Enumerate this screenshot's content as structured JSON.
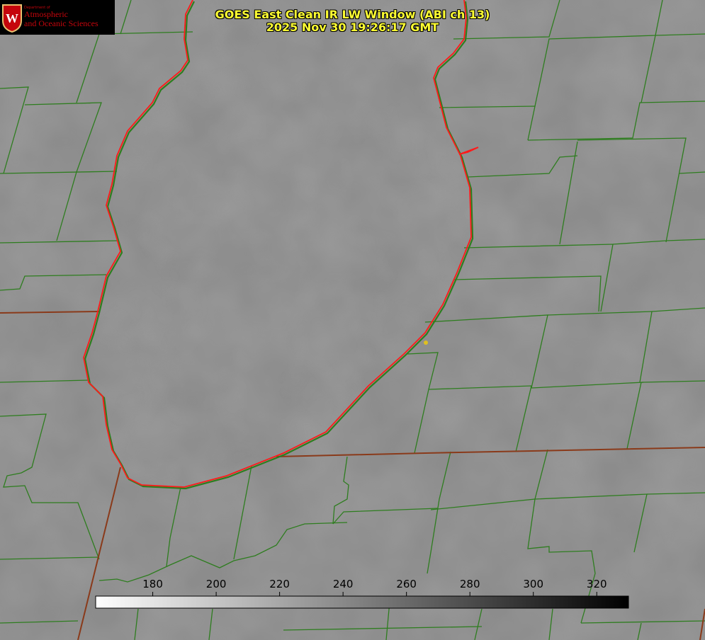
{
  "title": {
    "line1": "GOES East Clean IR LW Window (ABI ch 13)",
    "line2": "2025 Nov 30 19:26:17 GMT"
  },
  "logo": {
    "dept": "Department of",
    "line1": "Atmospheric",
    "line2": "and Oceanic Sciences",
    "seal_letter": "W"
  },
  "colorbar": {
    "ticks": [
      "180",
      "200",
      "220",
      "240",
      "260",
      "280",
      "300",
      "320"
    ],
    "tick_values": [
      180,
      200,
      220,
      240,
      260,
      280,
      300,
      320
    ],
    "min": 162,
    "max": 330
  },
  "colors": {
    "title": "#ffff33",
    "county_border": "#2e7d1f",
    "state_border": "#8a3a1a",
    "lake_shore": "#ff1a1a",
    "marker": "#e0c020",
    "logo": "#c5050c"
  }
}
